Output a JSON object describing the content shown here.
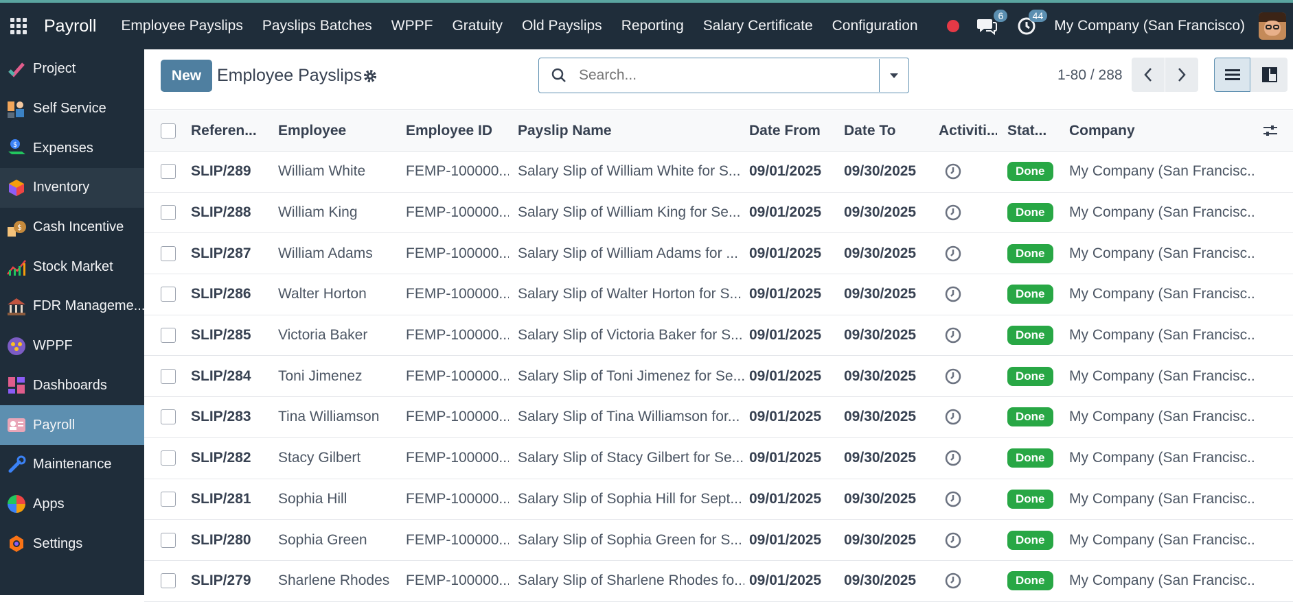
{
  "navbar": {
    "brand": "Payroll",
    "menu": [
      "Employee Payslips",
      "Payslips Batches",
      "WPPF",
      "Gratuity",
      "Old Payslips",
      "Reporting",
      "Salary Certificate",
      "Configuration"
    ],
    "messages_count": "6",
    "activities_count": "44",
    "company": "My Company (San Francisco)"
  },
  "sidebar": {
    "items": [
      {
        "label": "Project",
        "icon": "project-icon"
      },
      {
        "label": "Self Service",
        "icon": "self-service-icon"
      },
      {
        "label": "Expenses",
        "icon": "expenses-icon"
      },
      {
        "label": "Inventory",
        "icon": "inventory-icon"
      },
      {
        "label": "Cash Incentive",
        "icon": "cash-incentive-icon"
      },
      {
        "label": "Stock Market",
        "icon": "stock-market-icon"
      },
      {
        "label": "FDR Manageme...",
        "icon": "fdr-management-icon"
      },
      {
        "label": "WPPF",
        "icon": "wppf-icon"
      },
      {
        "label": "Dashboards",
        "icon": "dashboards-icon"
      },
      {
        "label": "Payroll",
        "icon": "payroll-icon"
      },
      {
        "label": "Maintenance",
        "icon": "maintenance-icon"
      },
      {
        "label": "Apps",
        "icon": "apps-icon"
      },
      {
        "label": "Settings",
        "icon": "settings-icon"
      }
    ],
    "active": "Payroll"
  },
  "control": {
    "new_label": "New",
    "title": "Employee Payslips",
    "search_placeholder": "Search...",
    "pager": "1-80 / 288"
  },
  "table": {
    "headers": {
      "reference": "Referen...",
      "employee": "Employee",
      "employee_id": "Employee ID",
      "payslip_name": "Payslip Name",
      "date_from": "Date From",
      "date_to": "Date To",
      "activities": "Activiti...",
      "status": "Stat...",
      "company": "Company"
    },
    "rows": [
      {
        "ref": "SLIP/289",
        "emp": "William White",
        "eid": "FEMP-100000...",
        "name": "Salary Slip of William White for S...",
        "from": "09/01/2025",
        "to": "09/30/2025",
        "status": "Done",
        "company": "My Company (San Francisc..."
      },
      {
        "ref": "SLIP/288",
        "emp": "William King",
        "eid": "FEMP-100000...",
        "name": "Salary Slip of William King for Se...",
        "from": "09/01/2025",
        "to": "09/30/2025",
        "status": "Done",
        "company": "My Company (San Francisc..."
      },
      {
        "ref": "SLIP/287",
        "emp": "William Adams",
        "eid": "FEMP-100000...",
        "name": "Salary Slip of William Adams for ...",
        "from": "09/01/2025",
        "to": "09/30/2025",
        "status": "Done",
        "company": "My Company (San Francisc..."
      },
      {
        "ref": "SLIP/286",
        "emp": "Walter Horton",
        "eid": "FEMP-100000...",
        "name": "Salary Slip of Walter Horton for S...",
        "from": "09/01/2025",
        "to": "09/30/2025",
        "status": "Done",
        "company": "My Company (San Francisc..."
      },
      {
        "ref": "SLIP/285",
        "emp": "Victoria Baker",
        "eid": "FEMP-100000...",
        "name": "Salary Slip of Victoria Baker for S...",
        "from": "09/01/2025",
        "to": "09/30/2025",
        "status": "Done",
        "company": "My Company (San Francisc..."
      },
      {
        "ref": "SLIP/284",
        "emp": "Toni Jimenez",
        "eid": "FEMP-100000...",
        "name": "Salary Slip of Toni Jimenez for Se...",
        "from": "09/01/2025",
        "to": "09/30/2025",
        "status": "Done",
        "company": "My Company (San Francisc..."
      },
      {
        "ref": "SLIP/283",
        "emp": "Tina Williamson",
        "eid": "FEMP-100000...",
        "name": "Salary Slip of Tina Williamson for...",
        "from": "09/01/2025",
        "to": "09/30/2025",
        "status": "Done",
        "company": "My Company (San Francisc..."
      },
      {
        "ref": "SLIP/282",
        "emp": "Stacy Gilbert",
        "eid": "FEMP-100000...",
        "name": "Salary Slip of Stacy Gilbert for Se...",
        "from": "09/01/2025",
        "to": "09/30/2025",
        "status": "Done",
        "company": "My Company (San Francisc..."
      },
      {
        "ref": "SLIP/281",
        "emp": "Sophia Hill",
        "eid": "FEMP-100000...",
        "name": "Salary Slip of Sophia Hill for Sept...",
        "from": "09/01/2025",
        "to": "09/30/2025",
        "status": "Done",
        "company": "My Company (San Francisc..."
      },
      {
        "ref": "SLIP/280",
        "emp": "Sophia Green",
        "eid": "FEMP-100000...",
        "name": "Salary Slip of Sophia Green for S...",
        "from": "09/01/2025",
        "to": "09/30/2025",
        "status": "Done",
        "company": "My Company (San Francisc..."
      },
      {
        "ref": "SLIP/279",
        "emp": "Sharlene Rhodes",
        "eid": "FEMP-100000...",
        "name": "Salary Slip of Sharlene Rhodes fo...",
        "from": "09/01/2025",
        "to": "09/30/2025",
        "status": "Done",
        "company": "My Company (San Francisc..."
      }
    ]
  },
  "colors": {
    "navbar_bg": "#1f2d3a",
    "accent": "#4f7fa0",
    "active_sidebar": "#5d8fb0",
    "done_badge": "#28a745"
  }
}
